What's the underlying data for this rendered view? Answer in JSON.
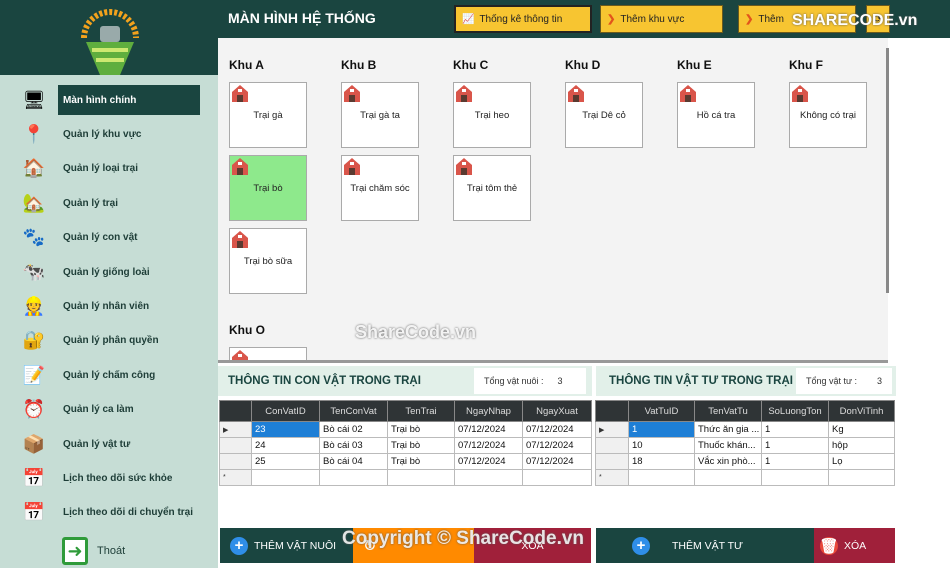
{
  "header": {
    "title": "MÀN HÌNH HỆ THỐNG",
    "buttons": [
      {
        "label": "Thống kê thông tin",
        "icon": "chart-icon"
      },
      {
        "label": "Thêm khu vực",
        "icon": "chevron-down-icon"
      },
      {
        "label": "Thêm",
        "icon": "chevron-down-icon"
      }
    ]
  },
  "sidebar": {
    "items": [
      {
        "label": "Màn hình chính",
        "icon": "monitor-icon",
        "active": true
      },
      {
        "label": "Quản lý khu vực",
        "icon": "location-pin-icon"
      },
      {
        "label": "Quản lý loại trại",
        "icon": "barn-icon"
      },
      {
        "label": "Quản lý trại",
        "icon": "farmhouse-icon"
      },
      {
        "label": "Quản lý con vật",
        "icon": "paw-icon"
      },
      {
        "label": "Quản lý giống loài",
        "icon": "animals-icon"
      },
      {
        "label": "Quản lý nhân viên",
        "icon": "employee-icon"
      },
      {
        "label": "Quản lý phân quyền",
        "icon": "permission-icon"
      },
      {
        "label": "Quản lý chấm công",
        "icon": "notepad-icon"
      },
      {
        "label": "Quản lý ca làm",
        "icon": "alarm-clock-icon"
      },
      {
        "label": "Quản lý vật tư",
        "icon": "warehouse-icon"
      },
      {
        "label": "Lịch theo dõi sức khỏe",
        "icon": "calendar-icon"
      },
      {
        "label": "Lịch theo dõi di chuyển trại",
        "icon": "calendar-icon"
      }
    ],
    "exit_label": "Thoát"
  },
  "zones": [
    {
      "name": "Khu A",
      "farms": [
        "Trại gà",
        "Trại bò",
        "Trại bò sữa"
      ],
      "selected": "Trại bò"
    },
    {
      "name": "Khu B",
      "farms": [
        "Trại gà ta",
        "Trại chăm sóc"
      ]
    },
    {
      "name": "Khu C",
      "farms": [
        "Trại heo",
        "Trại tôm thẻ"
      ]
    },
    {
      "name": "Khu D",
      "farms": [
        "Trại Dê cỏ"
      ]
    },
    {
      "name": "Khu E",
      "farms": [
        "Hồ cá tra"
      ]
    },
    {
      "name": "Khu F",
      "farms": [
        "Không có trại"
      ]
    },
    {
      "name": "Khu O",
      "farms": [
        ""
      ]
    }
  ],
  "animals": {
    "title": "THÔNG TIN CON VẬT TRONG TRẠI",
    "total_label": "Tổng vật nuôi :",
    "total": "3",
    "columns": [
      "ConVatID",
      "TenConVat",
      "TenTrai",
      "NgayNhap",
      "NgayXuat"
    ],
    "rows": [
      [
        "23",
        "Bò cái 02",
        "Trại bò",
        "07/12/2024",
        "07/12/2024"
      ],
      [
        "24",
        "Bò cái 03",
        "Trại bò",
        "07/12/2024",
        "07/12/2024"
      ],
      [
        "25",
        "Bò cái 04",
        "Trại bò",
        "07/12/2024",
        "07/12/2024"
      ]
    ],
    "buttons": {
      "add": "THÊM VẬT NUÔI",
      "update": "",
      "delete": "XÓA"
    }
  },
  "supplies": {
    "title": "THÔNG TIN VẬT TƯ TRONG TRẠI",
    "total_label": "Tổng vật tư :",
    "total": "3",
    "columns": [
      "VatTuID",
      "TenVatTu",
      "SoLuongTon",
      "DonViTinh"
    ],
    "rows": [
      [
        "1",
        "Thức ăn gia ...",
        "1",
        "Kg"
      ],
      [
        "10",
        "Thuốc khán...",
        "1",
        "hộp"
      ],
      [
        "18",
        "Vắc xin phò...",
        "1",
        "Lọ"
      ]
    ],
    "buttons": {
      "add": "THÊM VẬT TƯ",
      "delete": "XÓA"
    }
  },
  "watermarks": [
    "SHARECODE.vn",
    "ShareCode.vn",
    "Copyright © ShareCode.vn"
  ],
  "colors": {
    "dark_green": "#1a4540",
    "sidebar": "#c6ddd5",
    "yellow": "#f7c531",
    "orange": "#ff8a00",
    "red": "#a0203a",
    "selected_farm": "#8ee98c"
  }
}
